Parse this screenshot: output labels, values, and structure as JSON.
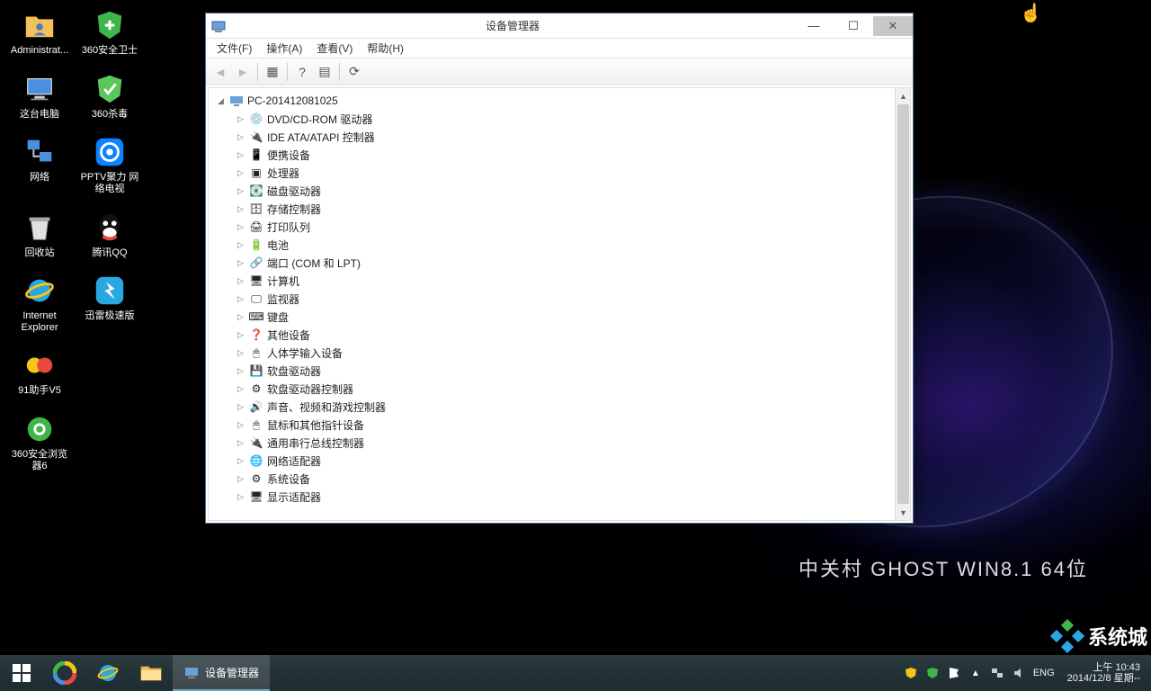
{
  "desktop": {
    "brand": "中关村  GHOST  WIN8.1  64位",
    "icons": [
      {
        "name": "administrator",
        "label": "Administrat...",
        "glyph": "folder-user"
      },
      {
        "name": "360-safe",
        "label": "360安全卫士",
        "glyph": "shield-green"
      },
      {
        "name": "this-pc",
        "label": "这台电脑",
        "glyph": "pc"
      },
      {
        "name": "360-antivirus",
        "label": "360杀毒",
        "glyph": "shield-green2"
      },
      {
        "name": "network",
        "label": "网络",
        "glyph": "network"
      },
      {
        "name": "pptv",
        "label": "PPTV聚力 网络电视",
        "glyph": "pptv"
      },
      {
        "name": "recycle-bin",
        "label": "回收站",
        "glyph": "bin"
      },
      {
        "name": "qq",
        "label": "腾讯QQ",
        "glyph": "qq"
      },
      {
        "name": "ie",
        "label": "Internet Explorer",
        "glyph": "ie"
      },
      {
        "name": "thunder",
        "label": "迅雷极速版",
        "glyph": "thunder"
      },
      {
        "name": "91-helper",
        "label": "91助手V5",
        "glyph": "91"
      },
      {
        "name": "blank",
        "label": "",
        "glyph": ""
      },
      {
        "name": "360-browser",
        "label": "360安全浏览器6",
        "glyph": "360se"
      }
    ]
  },
  "window": {
    "title": "设备管理器",
    "menus": [
      "文件(F)",
      "操作(A)",
      "查看(V)",
      "帮助(H)"
    ],
    "toolbar": [
      {
        "name": "back",
        "glyph": "◄",
        "disabled": true
      },
      {
        "name": "forward",
        "glyph": "►",
        "disabled": true
      },
      {
        "name": "sep"
      },
      {
        "name": "show-hide",
        "glyph": "▦"
      },
      {
        "name": "sep"
      },
      {
        "name": "help",
        "glyph": "?"
      },
      {
        "name": "props",
        "glyph": "▤"
      },
      {
        "name": "sep"
      },
      {
        "name": "scan",
        "glyph": "⟳"
      }
    ],
    "tree": {
      "root": "PC-201412081025",
      "children": [
        "DVD/CD-ROM 驱动器",
        "IDE ATA/ATAPI 控制器",
        "便携设备",
        "处理器",
        "磁盘驱动器",
        "存储控制器",
        "打印队列",
        "电池",
        "端口 (COM 和 LPT)",
        "计算机",
        "监视器",
        "键盘",
        "其他设备",
        "人体学输入设备",
        "软盘驱动器",
        "软盘驱动器控制器",
        "声音、视频和游戏控制器",
        "鼠标和其他指针设备",
        "通用串行总线控制器",
        "网络适配器",
        "系统设备",
        "显示适配器"
      ]
    }
  },
  "taskbar": {
    "task_label": "设备管理器",
    "lang": "ENG",
    "clock_time": "上午 10:43",
    "clock_date": "2014/12/8 星期--"
  },
  "watermark": "系统城"
}
